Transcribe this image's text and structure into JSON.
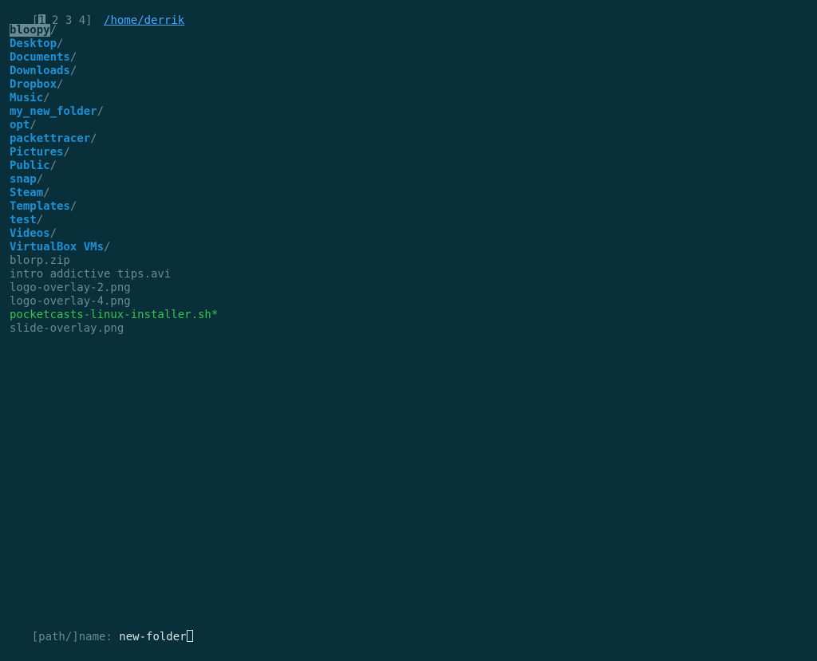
{
  "header": {
    "tabs_open": "[",
    "tab_active": "1",
    "tabs_rest": " 2 3 4",
    "tabs_close": "]",
    "cwd": "/home/derrik"
  },
  "listing": [
    {
      "name": "bloopy",
      "type": "dir",
      "selected": true
    },
    {
      "name": "Desktop",
      "type": "dir",
      "selected": false
    },
    {
      "name": "Documents",
      "type": "dir",
      "selected": false
    },
    {
      "name": "Downloads",
      "type": "dir",
      "selected": false
    },
    {
      "name": "Dropbox",
      "type": "dir",
      "selected": false
    },
    {
      "name": "Music",
      "type": "dir",
      "selected": false
    },
    {
      "name": "my_new_folder",
      "type": "dir",
      "selected": false
    },
    {
      "name": "opt",
      "type": "dir",
      "selected": false
    },
    {
      "name": "packettracer",
      "type": "dir",
      "selected": false
    },
    {
      "name": "Pictures",
      "type": "dir",
      "selected": false
    },
    {
      "name": "Public",
      "type": "dir",
      "selected": false
    },
    {
      "name": "snap",
      "type": "dir",
      "selected": false
    },
    {
      "name": "Steam",
      "type": "dir",
      "selected": false
    },
    {
      "name": "Templates",
      "type": "dir",
      "selected": false
    },
    {
      "name": "test",
      "type": "dir",
      "selected": false
    },
    {
      "name": "Videos",
      "type": "dir",
      "selected": false
    },
    {
      "name": "VirtualBox VMs",
      "type": "dir",
      "selected": false
    },
    {
      "name": "blorp.zip",
      "type": "file"
    },
    {
      "name": "intro addictive tips.avi",
      "type": "file"
    },
    {
      "name": "logo-overlay-2.png",
      "type": "file"
    },
    {
      "name": "logo-overlay-4.png",
      "type": "file"
    },
    {
      "name": "pocketcasts-linux-installer.sh",
      "type": "exec",
      "suffix": "*"
    },
    {
      "name": "slide-overlay.png",
      "type": "file"
    }
  ],
  "prompt": {
    "label": "[path/]name: ",
    "value": "new-folder"
  }
}
